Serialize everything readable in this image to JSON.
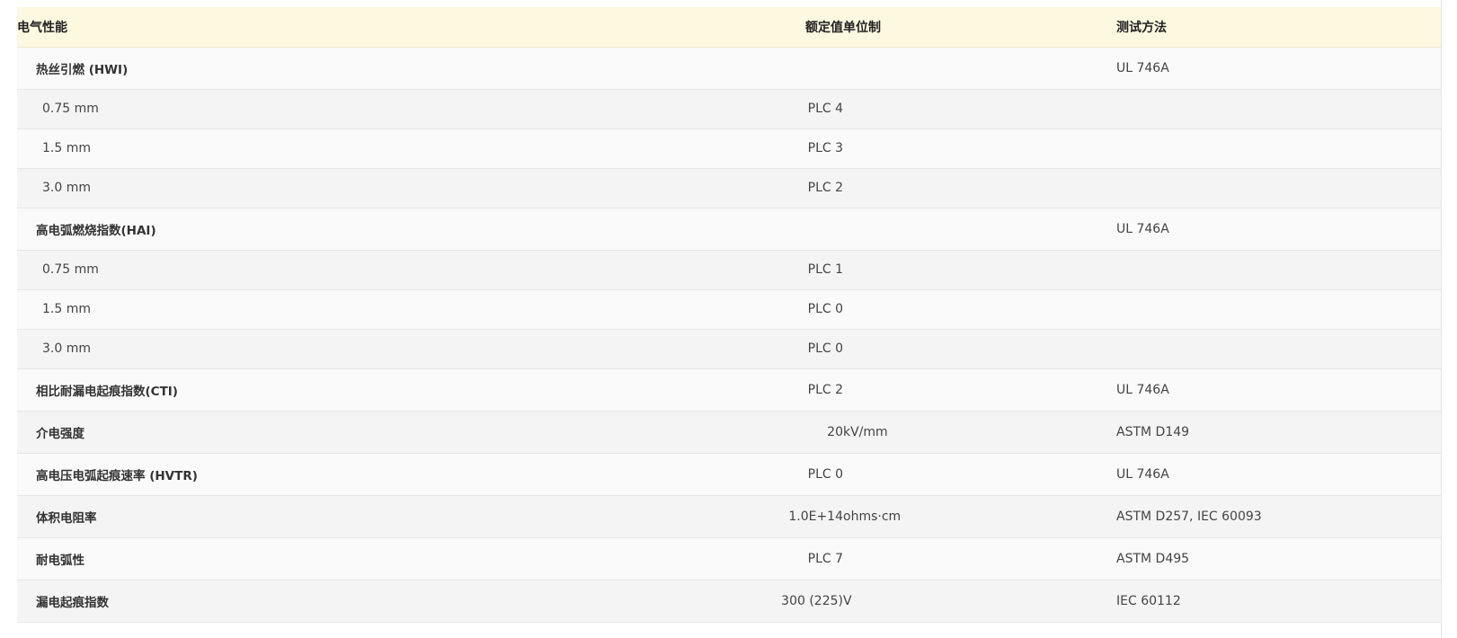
{
  "table": {
    "headers": [
      "电气性能",
      "额定值",
      "单位制",
      "测试方法"
    ],
    "rows": [
      {
        "type": "group",
        "name": "热丝引燃 (HWI)",
        "value": "",
        "unit": "",
        "method": "UL 746A"
      },
      {
        "type": "sub",
        "name": "0.75 mm",
        "value": "PLC 4",
        "unit": "",
        "method": ""
      },
      {
        "type": "sub",
        "name": "1.5 mm",
        "value": "PLC 3",
        "unit": "",
        "method": ""
      },
      {
        "type": "sub",
        "name": "3.0 mm",
        "value": "PLC 2",
        "unit": "",
        "method": ""
      },
      {
        "type": "group",
        "name": "高电弧燃烧指数(HAI)",
        "value": "",
        "unit": "",
        "method": "UL 746A"
      },
      {
        "type": "sub",
        "name": "0.75 mm",
        "value": "PLC 1",
        "unit": "",
        "method": ""
      },
      {
        "type": "sub",
        "name": "1.5 mm",
        "value": "PLC 0",
        "unit": "",
        "method": ""
      },
      {
        "type": "sub",
        "name": "3.0 mm",
        "value": "PLC 0",
        "unit": "",
        "method": ""
      },
      {
        "type": "group",
        "name": "相比耐漏电起痕指数(CTI)",
        "value": "PLC 2",
        "unit": "",
        "method": "UL 746A"
      },
      {
        "type": "group",
        "name": "介电强度",
        "value": "20",
        "unit": "kV/mm",
        "method": "ASTM D149"
      },
      {
        "type": "group",
        "name": "高电压电弧起痕速率 (HVTR)",
        "value": "PLC 0",
        "unit": "",
        "method": "UL 746A"
      },
      {
        "type": "group",
        "name": "体积电阻率",
        "value": "1.0E+14",
        "unit": "ohms·cm",
        "method": "ASTM D257, IEC 60093"
      },
      {
        "type": "group",
        "name": "耐电弧性",
        "value": "PLC 7",
        "unit": "",
        "method": "ASTM D495"
      },
      {
        "type": "group",
        "name": "漏电起痕指数",
        "value": "300 (225)",
        "unit": "V",
        "method": "IEC 60112"
      }
    ]
  },
  "colors": {
    "header_bg": "#fdf8e0",
    "row_odd": "#fafafa",
    "row_even": "#f4f4f4",
    "border": "#e6e6e6"
  }
}
